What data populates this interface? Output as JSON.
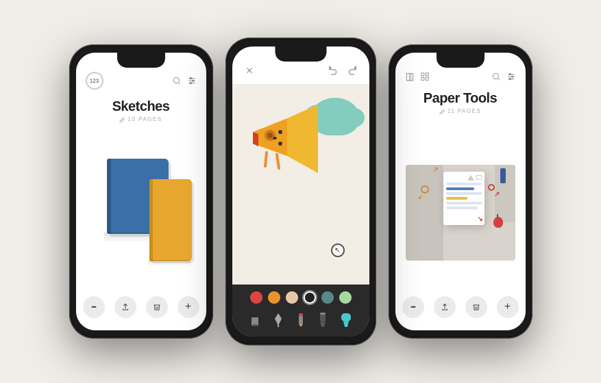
{
  "background_color": "#f0ede8",
  "phones": [
    {
      "id": "phone1",
      "screen": "sketches",
      "header": {
        "badge": "123",
        "icons": [
          "search",
          "sliders"
        ]
      },
      "title": "Sketches",
      "subtitle": "10 PAGES",
      "illustration": "books",
      "footer_buttons": [
        "more",
        "share",
        "delete",
        "add"
      ]
    },
    {
      "id": "phone2",
      "screen": "drawing",
      "header_icons": [
        "close",
        "undo",
        "redo"
      ],
      "illustration": "megaphone",
      "colors": [
        {
          "color": "#d44",
          "label": "red"
        },
        {
          "color": "#e8942a",
          "label": "orange"
        },
        {
          "color": "#e8d5c0",
          "label": "peach"
        },
        {
          "color": "#222",
          "label": "black",
          "selected": true
        },
        {
          "color": "#5a8a8a",
          "label": "teal"
        },
        {
          "color": "#aad8a8",
          "label": "green"
        }
      ],
      "tools": [
        "eraser",
        "pen",
        "pencil",
        "marker",
        "highlighter"
      ]
    },
    {
      "id": "phone3",
      "screen": "paper-tools",
      "header_left": [
        "book",
        "grid"
      ],
      "header_right": [
        "search",
        "sliders"
      ],
      "title": "Paper Tools",
      "subtitle": "11 PAGES",
      "illustration": "document-3d",
      "footer_buttons": [
        "more",
        "share",
        "delete",
        "add"
      ]
    }
  ],
  "footer_button_labels": {
    "more": "•••",
    "share": "↑",
    "delete": "🗑",
    "add": "+"
  }
}
